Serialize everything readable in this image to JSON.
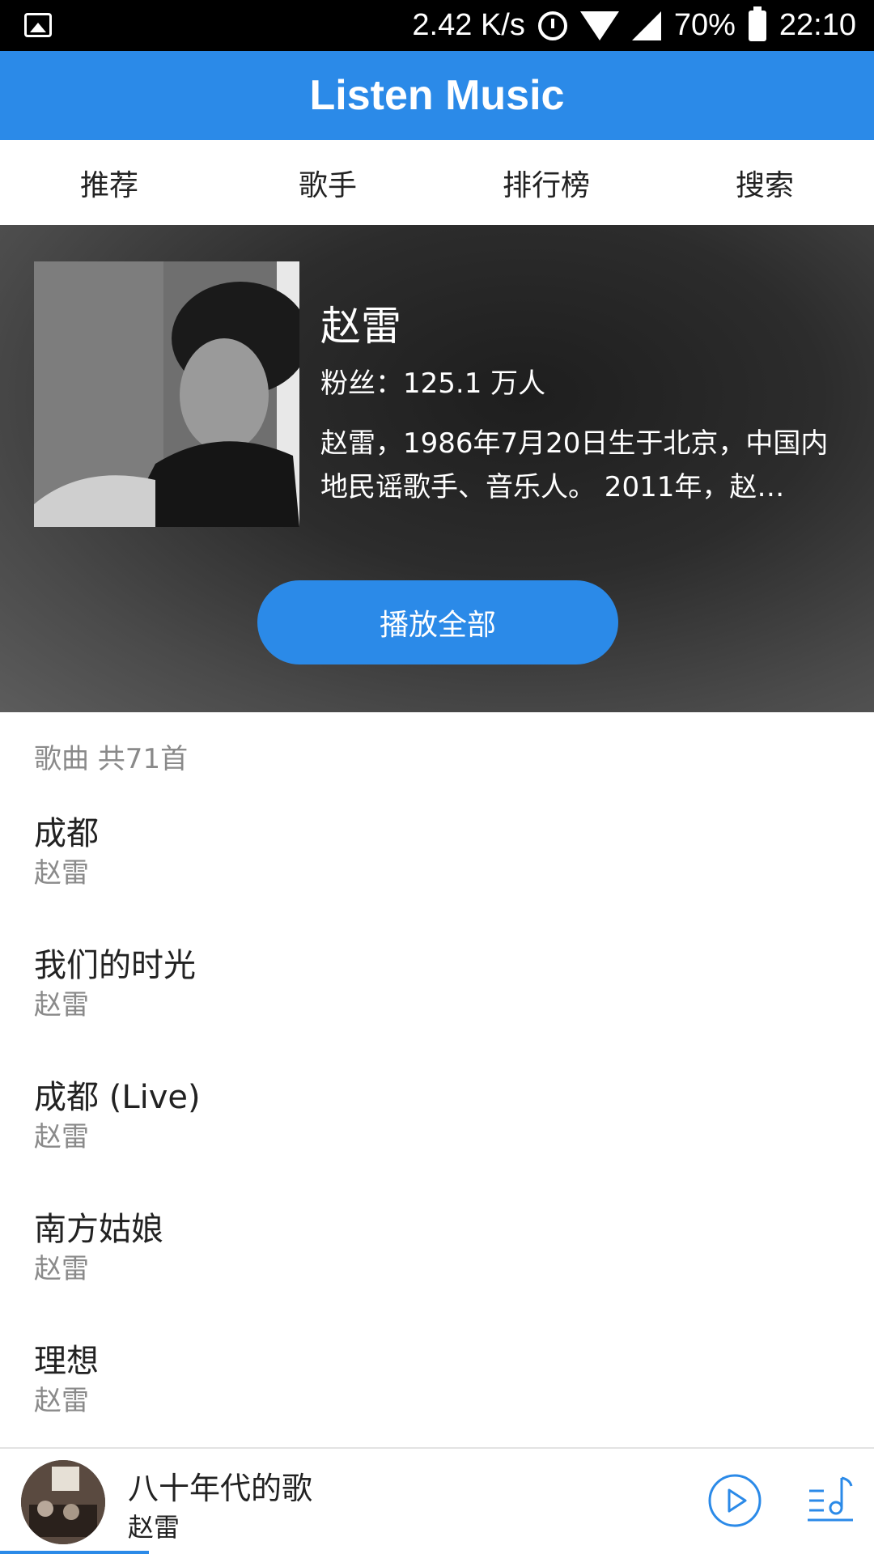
{
  "status_bar": {
    "speed": "2.42 K/s",
    "battery": "70%",
    "time": "22:10",
    "icons": [
      "image-icon",
      "alarm-icon",
      "wifi-icon",
      "signal-icon",
      "battery-icon"
    ]
  },
  "app_bar": {
    "title": "Listen Music"
  },
  "tabs": [
    {
      "label": "推荐"
    },
    {
      "label": "歌手"
    },
    {
      "label": "排行榜"
    },
    {
      "label": "搜索"
    }
  ],
  "artist": {
    "name": "赵雷",
    "fans": "粉丝：125.1 万人",
    "description": "赵雷，1986年7月20日生于北京，中国内地民谣歌手、音乐人。 2011年，赵…",
    "play_all_label": "播放全部"
  },
  "song_count": "歌曲 共71首",
  "songs": [
    {
      "title": "成都",
      "artist": "赵雷"
    },
    {
      "title": "我们的时光",
      "artist": "赵雷"
    },
    {
      "title": "成都 (Live)",
      "artist": "赵雷"
    },
    {
      "title": "南方姑娘",
      "artist": "赵雷"
    },
    {
      "title": "理想",
      "artist": "赵雷"
    }
  ],
  "now_playing": {
    "title": "八十年代的歌",
    "artist": "赵雷",
    "progress": 0.17,
    "icons": [
      "play-circle-icon",
      "playlist-icon"
    ]
  },
  "colors": {
    "accent": "#2b8ae8",
    "text_primary": "#222222",
    "text_secondary": "#8a8a8a"
  }
}
